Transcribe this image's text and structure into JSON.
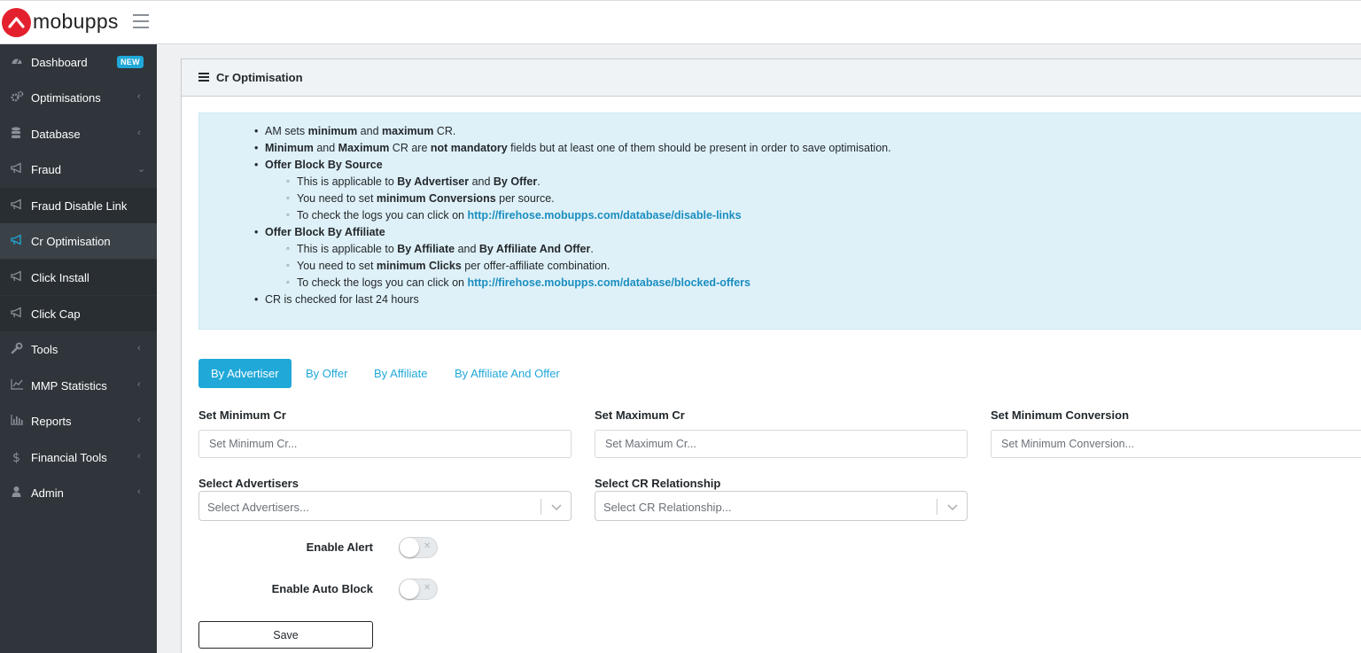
{
  "brand": {
    "name": "mobupps",
    "accent": "#e3212e"
  },
  "sidebar": {
    "items": [
      {
        "label": "Dashboard",
        "icon": "dashboard-icon",
        "badge": "NEW"
      },
      {
        "label": "Optimisations",
        "icon": "cogs-icon",
        "chevron": "‹"
      },
      {
        "label": "Database",
        "icon": "database-icon",
        "chevron": "‹"
      },
      {
        "label": "Fraud",
        "icon": "bullhorn-icon",
        "chevron": "⌄"
      },
      {
        "label": "Fraud Disable Link",
        "icon": "bullhorn-icon"
      },
      {
        "label": "Cr Optimisation",
        "icon": "bullhorn-icon",
        "active": true
      },
      {
        "label": "Click Install",
        "icon": "bullhorn-icon"
      },
      {
        "label": "Click Cap",
        "icon": "bullhorn-icon"
      },
      {
        "label": "Tools",
        "icon": "wrench-icon",
        "chevron": "‹"
      },
      {
        "label": "MMP Statistics",
        "icon": "line-chart-icon",
        "chevron": "‹"
      },
      {
        "label": "Reports",
        "icon": "bar-chart-icon",
        "chevron": "‹"
      },
      {
        "label": "Financial Tools",
        "icon": "dollar-icon",
        "chevron": "‹"
      },
      {
        "label": "Admin",
        "icon": "user-icon",
        "chevron": "‹"
      }
    ]
  },
  "card": {
    "title": "Cr Optimisation",
    "info": {
      "l1": {
        "a": "AM sets ",
        "b": "minimum",
        "c": " and ",
        "d": "maximum",
        "e": " CR."
      },
      "l2": {
        "a": "Minimum",
        "b": " and ",
        "c": "Maximum",
        "d": " CR are ",
        "e": "not mandatory",
        "f": " fields but at least one of them should be present in order to save optimisation."
      },
      "l3": "Offer Block By Source",
      "l4": {
        "a": "This is applicable to ",
        "b": "By Advertiser",
        "c": " and ",
        "d": "By Offer",
        "e": "."
      },
      "l5": {
        "a": "You need to set ",
        "b": "minimum Conversions",
        "c": " per source."
      },
      "l6": {
        "a": "To check the logs you can click on ",
        "link": "http://firehose.mobupps.com/database/disable-links"
      },
      "l7": "Offer Block By Affiliate",
      "l8": {
        "a": "This is applicable to ",
        "b": "By Affiliate",
        "c": " and ",
        "d": "By Affiliate And Offer",
        "e": "."
      },
      "l9": {
        "a": "You need to set ",
        "b": "minimum Clicks",
        "c": " per offer-affiliate combination."
      },
      "l10": {
        "a": "To check the logs you can click on ",
        "link": "http://firehose.mobupps.com/database/blocked-offers"
      },
      "l11": "CR is checked for last 24 hours"
    },
    "tabs": [
      "By Advertiser",
      "By Offer",
      "By Affiliate",
      "By Affiliate And Offer"
    ],
    "form": {
      "min_cr": {
        "label": "Set Minimum Cr",
        "placeholder": "Set Minimum Cr..."
      },
      "max_cr": {
        "label": "Set Maximum Cr",
        "placeholder": "Set Maximum Cr..."
      },
      "min_conv": {
        "label": "Set Minimum Conversion",
        "placeholder": "Set Minimum Conversion..."
      },
      "advertisers": {
        "label": "Select Advertisers",
        "placeholder": "Select Advertisers..."
      },
      "cr_relationship": {
        "label": "Select CR Relationship",
        "placeholder": "Select CR Relationship..."
      },
      "enable_alert": {
        "label": "Enable Alert",
        "mark": "✕"
      },
      "enable_auto_block": {
        "label": "Enable Auto Block",
        "mark": "✕"
      },
      "save": "Save"
    }
  }
}
